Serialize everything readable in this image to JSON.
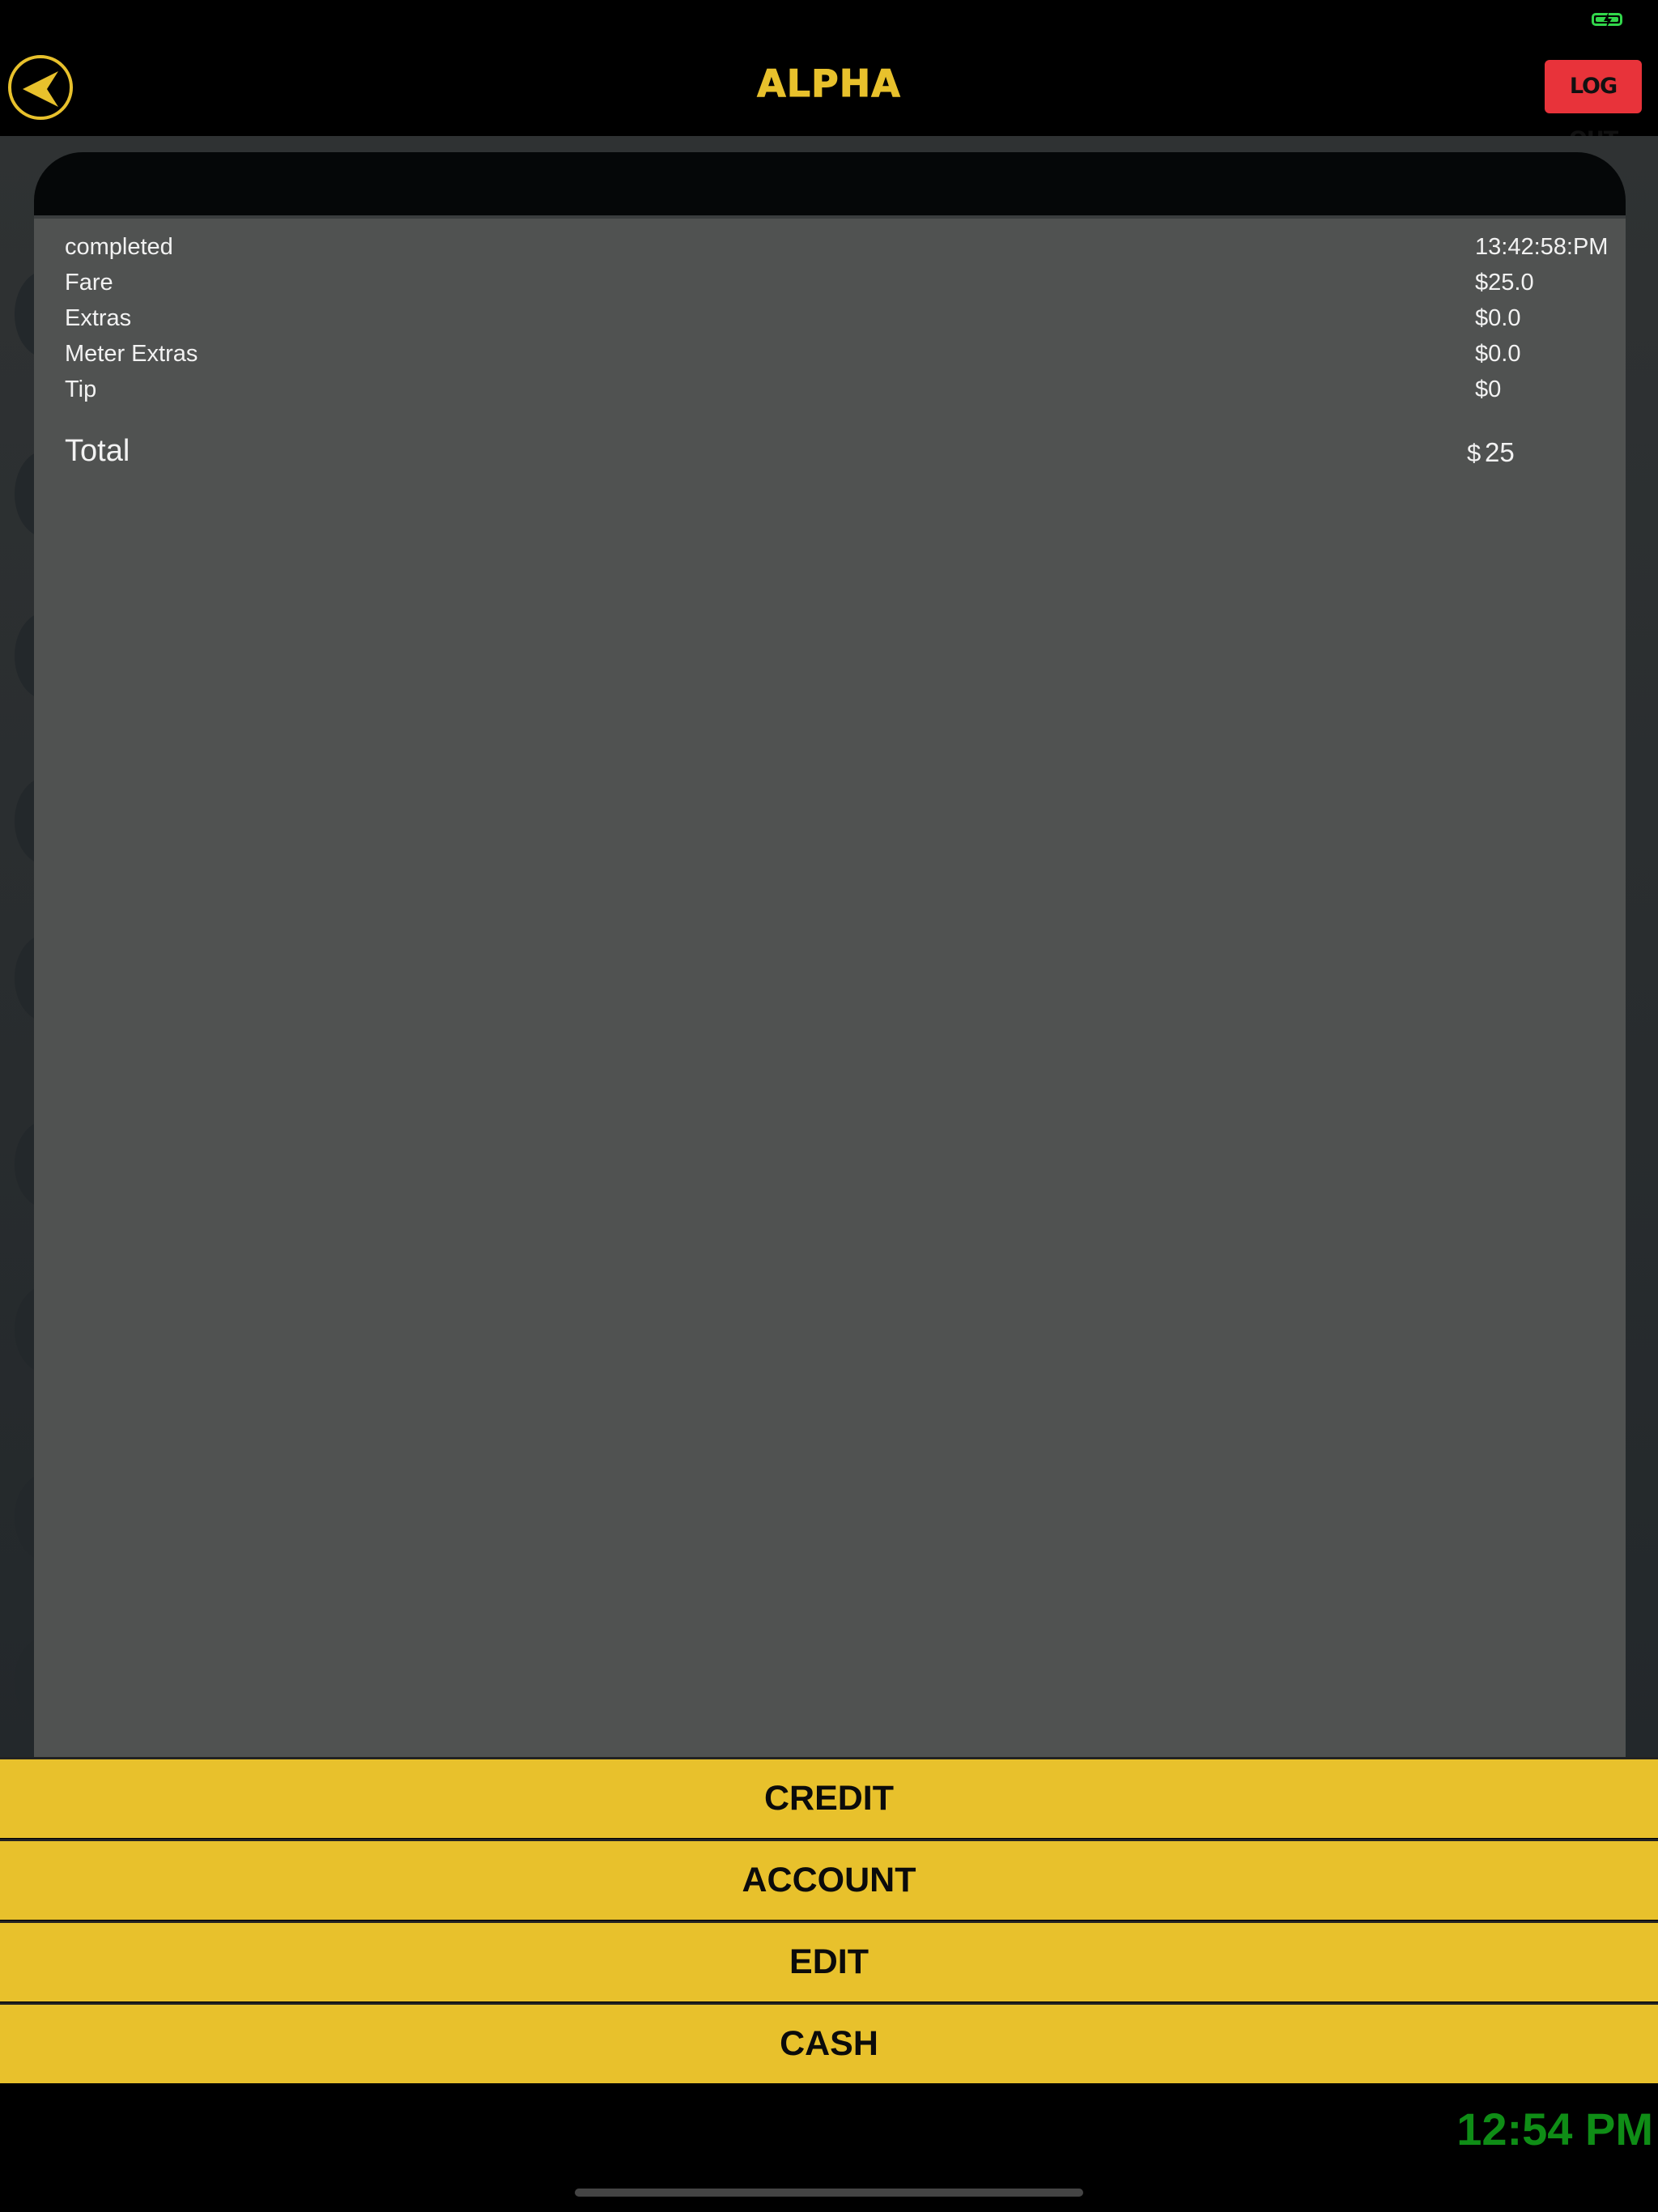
{
  "header": {
    "title": "ALPHA",
    "logout_label": "LOG OUT",
    "back_icon": "chevron-left-icon"
  },
  "status_bar": {
    "battery_icon": "battery-charging-icon",
    "battery_color": "#32d74b"
  },
  "receipt": {
    "rows": [
      {
        "label": "completed",
        "value": "13:42:58:PM"
      },
      {
        "label": "Fare",
        "value": "$25.0"
      },
      {
        "label": "Extras",
        "value": "$0.0"
      },
      {
        "label": "Meter Extras",
        "value": "$0.0"
      },
      {
        "label": "Tip",
        "value": "$0"
      }
    ],
    "total_label": "Total",
    "total_currency": "$",
    "total_value": "25"
  },
  "actions": {
    "credit": "CREDIT",
    "account": "ACCOUNT",
    "edit": "EDIT",
    "cash": "CASH"
  },
  "footer": {
    "clock": "12:54 PM"
  },
  "colors": {
    "accent_yellow": "#e8c12c",
    "logout_red": "#e8333a",
    "clock_green": "#0f8d16",
    "paper_gray": "#505251"
  }
}
